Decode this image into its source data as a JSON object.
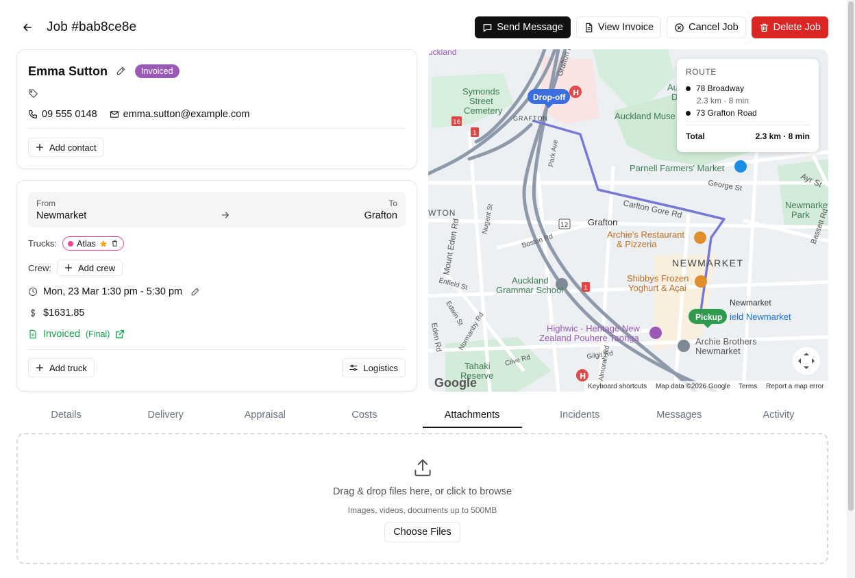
{
  "header": {
    "title": "Job #bab8ce8e",
    "actions": {
      "send_message": "Send Message",
      "view_invoice": "View Invoice",
      "cancel_job": "Cancel Job",
      "delete_job": "Delete Job"
    }
  },
  "contact": {
    "name": "Emma Sutton",
    "status_badge": "Invoiced",
    "phone": "09 555 0148",
    "email": "emma.sutton@example.com",
    "add_contact_label": "Add contact"
  },
  "job": {
    "from_label": "From",
    "from_value": "Newmarket",
    "to_label": "To",
    "to_value": "Grafton",
    "trucks_label": "Trucks:",
    "truck_name": "Atlas",
    "crew_label": "Crew:",
    "add_crew_label": "Add crew",
    "schedule": "Mon, 23 Mar 1:30 pm - 5:30 pm",
    "price": "$1631.85",
    "invoice_status": "Invoiced",
    "invoice_type": "(Final)",
    "add_truck_label": "Add truck",
    "logistics_label": "Logistics"
  },
  "map": {
    "labels": {
      "dropoff_marker": "Drop-off",
      "pickup_marker": "Pickup",
      "grafton_rd": "Grafton Rd",
      "grafton_area": "GRAFTON",
      "symonds": "Symonds",
      "street": "Street",
      "cemetery": "Cemetery",
      "auckland_museum": "Auckland Muse",
      "auckland_domain_1": "Auckla",
      "auckland_domain_2": "Doma",
      "parnell_market": "Parnell Farmers' Market",
      "george_st": "George St",
      "ayr_st": "Ayr St",
      "newmarket_park_1": "Newmarket",
      "newmarket_park_2": "Park",
      "carlton_gore_rd": "Carlton Gore Rd",
      "park_ave": "Park Ave",
      "grafton_station": "Grafton",
      "boston_rd": "Boston Rd",
      "nugent_st": "Nugent St",
      "mount_eden_rd": "Mount Eden Rd",
      "archies_1": "Archie's Restaurant",
      "archies_2": "& Pizzeria",
      "newmarket_area": "NEWMARKET",
      "shibbys_1": "Shibbys Frozen",
      "shibbys_2": "Yoghurt & Açai",
      "enfield_st": "Enfield St",
      "auckland_grammar_1": "Auckland",
      "auckland_grammar_2": "Grammar School",
      "newmarket_station": "Newmarket",
      "westfield": "ield Newmarket",
      "edwin_st": "Edwin St",
      "eden_rd": "Eden Rd",
      "normanby_rd": "Normanby Rd",
      "highwic_1": "Highwic - Heritage New",
      "highwic_2": "Zealand Pouhere Taonga",
      "archie_brothers_1": "Archie Brothers",
      "archie_brothers_2": "Newmarket",
      "gilgit_rd": "Gilgit Rd",
      "clive_rd": "Clive Rd",
      "almorah_rd": "Almorah Rd",
      "tahaki_1": "Tahaki",
      "tahaki_2": "Reserve",
      "wton": "WTON",
      "bassett_rd": "Bassett Rd",
      "cluckland": "uckland",
      "shield_16": "16",
      "shield_1": "1",
      "shield_12": "12",
      "google": "Google",
      "shortcuts": "Keyboard shortcuts",
      "map_data": "Map data ©2026 Google",
      "terms": "Terms",
      "report": "Report a map error"
    },
    "route": {
      "title": "ROUTE",
      "stop1": "78 Broadway",
      "leg_meta": "2.3 km · 8 min",
      "stop2": "73 Grafton Road",
      "total_label": "Total",
      "total_value": "2.3 km · 8 min"
    }
  },
  "tabs": [
    "Details",
    "Delivery",
    "Appraisal",
    "Costs",
    "Attachments",
    "Incidents",
    "Messages",
    "Activity"
  ],
  "attachments": {
    "drop_text": "Drag & drop files here, or click to browse",
    "sub_text": "Images, videos, documents up to 500MB",
    "choose_label": "Choose Files"
  },
  "colors": {
    "badge_invoiced": "#9b59b6",
    "delete": "#dc2626",
    "truck_chip": "#ec4899",
    "route_line": "#7777d4",
    "pickup": "#2e9b4f",
    "dropoff": "#3c6ee0"
  }
}
